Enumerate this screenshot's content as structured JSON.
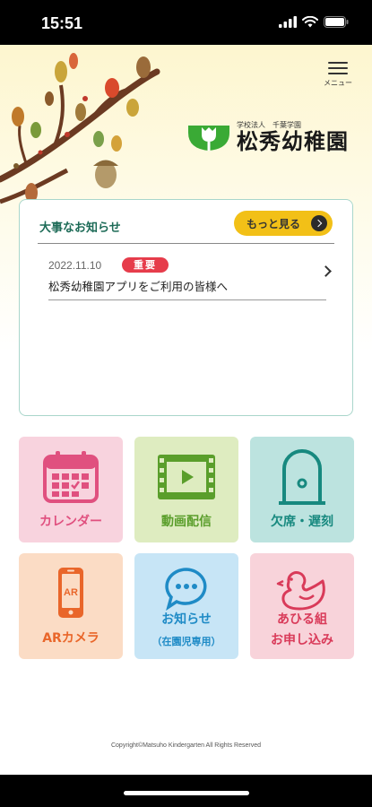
{
  "status": {
    "time": "15:51"
  },
  "menu": {
    "label": "メニュー"
  },
  "logo": {
    "sub": "学校法人　千葉学園",
    "name": "松秀幼稚園"
  },
  "notice": {
    "heading": "大事なお知らせ",
    "more_label": "もっと見る",
    "items": [
      {
        "date": "2022.11.10",
        "badge": "重要",
        "title": "松秀幼稚園アプリをご利用の皆様へ"
      }
    ]
  },
  "tiles": [
    {
      "label": "カレンダー",
      "color": "#e0507f"
    },
    {
      "label": "動画配信",
      "color": "#5a9e2b"
    },
    {
      "label": "欠席・遅刻",
      "color": "#17897f"
    },
    {
      "label": "ARカメラ",
      "color": "#e9662a"
    },
    {
      "label": "お知らせ",
      "label2": "（在園児専用）",
      "color": "#1f8bc6"
    },
    {
      "label": "あひる組",
      "label2": "お申し込み",
      "color": "#d93a59"
    }
  ],
  "footer": {
    "copyright": "Copyright©Matsuho Kindergarten All Rights Reserved"
  }
}
